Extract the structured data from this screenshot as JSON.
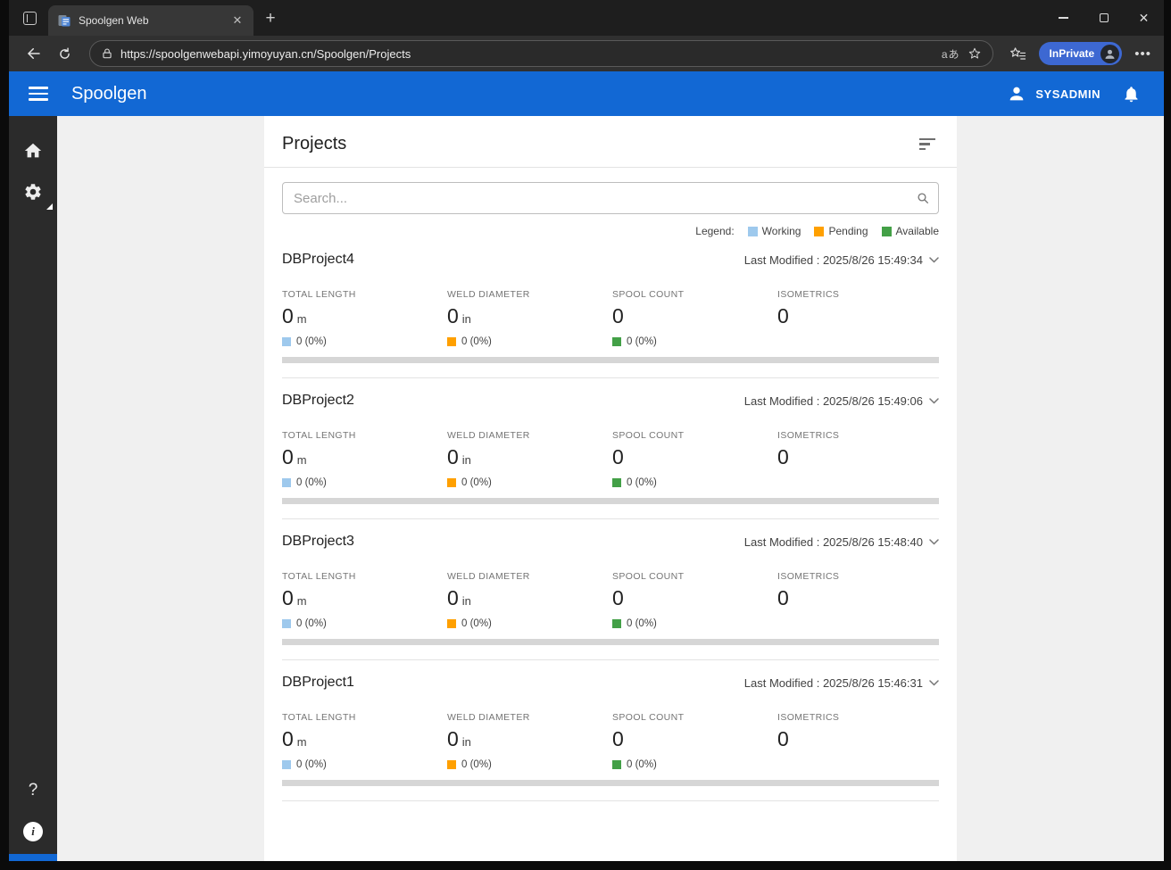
{
  "browser": {
    "tab_title": "Spoolgen Web",
    "url": "https://spoolgenwebapi.yimoyuyan.cn/Spoolgen/Projects",
    "translate_icon_text": "aあ",
    "inprivate_label": "InPrivate"
  },
  "app_header": {
    "title": "Spoolgen",
    "user": "SYSADMIN"
  },
  "page": {
    "title": "Projects",
    "search_placeholder": "Search..."
  },
  "legend": {
    "label": "Legend:",
    "items": [
      {
        "key": "working",
        "label": "Working",
        "color": "#9ec9ed"
      },
      {
        "key": "pending",
        "label": "Pending",
        "color": "#ffa000"
      },
      {
        "key": "available",
        "label": "Available",
        "color": "#43a047"
      }
    ]
  },
  "projects": [
    {
      "name": "DBProject4",
      "last_modified": "Last Modified : 2025/8/26 15:49:34",
      "stats": [
        {
          "label": "TOTAL LENGTH",
          "value": "0",
          "unit": "m",
          "legend_key": "working",
          "sub": "0 (0%)"
        },
        {
          "label": "WELD DIAMETER",
          "value": "0",
          "unit": "in",
          "legend_key": "pending",
          "sub": "0 (0%)"
        },
        {
          "label": "SPOOL COUNT",
          "value": "0",
          "unit": "",
          "legend_key": "available",
          "sub": "0 (0%)"
        },
        {
          "label": "ISOMETRICS",
          "value": "0",
          "unit": "",
          "legend_key": null,
          "sub": ""
        }
      ]
    },
    {
      "name": "DBProject2",
      "last_modified": "Last Modified : 2025/8/26 15:49:06",
      "stats": [
        {
          "label": "TOTAL LENGTH",
          "value": "0",
          "unit": "m",
          "legend_key": "working",
          "sub": "0 (0%)"
        },
        {
          "label": "WELD DIAMETER",
          "value": "0",
          "unit": "in",
          "legend_key": "pending",
          "sub": "0 (0%)"
        },
        {
          "label": "SPOOL COUNT",
          "value": "0",
          "unit": "",
          "legend_key": "available",
          "sub": "0 (0%)"
        },
        {
          "label": "ISOMETRICS",
          "value": "0",
          "unit": "",
          "legend_key": null,
          "sub": ""
        }
      ]
    },
    {
      "name": "DBProject3",
      "last_modified": "Last Modified : 2025/8/26 15:48:40",
      "stats": [
        {
          "label": "TOTAL LENGTH",
          "value": "0",
          "unit": "m",
          "legend_key": "working",
          "sub": "0 (0%)"
        },
        {
          "label": "WELD DIAMETER",
          "value": "0",
          "unit": "in",
          "legend_key": "pending",
          "sub": "0 (0%)"
        },
        {
          "label": "SPOOL COUNT",
          "value": "0",
          "unit": "",
          "legend_key": "available",
          "sub": "0 (0%)"
        },
        {
          "label": "ISOMETRICS",
          "value": "0",
          "unit": "",
          "legend_key": null,
          "sub": ""
        }
      ]
    },
    {
      "name": "DBProject1",
      "last_modified": "Last Modified : 2025/8/26 15:46:31",
      "stats": [
        {
          "label": "TOTAL LENGTH",
          "value": "0",
          "unit": "m",
          "legend_key": "working",
          "sub": "0 (0%)"
        },
        {
          "label": "WELD DIAMETER",
          "value": "0",
          "unit": "in",
          "legend_key": "pending",
          "sub": "0 (0%)"
        },
        {
          "label": "SPOOL COUNT",
          "value": "0",
          "unit": "",
          "legend_key": "available",
          "sub": "0 (0%)"
        },
        {
          "label": "ISOMETRICS",
          "value": "0",
          "unit": "",
          "legend_key": null,
          "sub": ""
        }
      ]
    }
  ],
  "colors": {
    "header_blue": "#1268d4",
    "inprivate_pill": "#3d68d2",
    "progress_track": "#d6d6d6"
  }
}
